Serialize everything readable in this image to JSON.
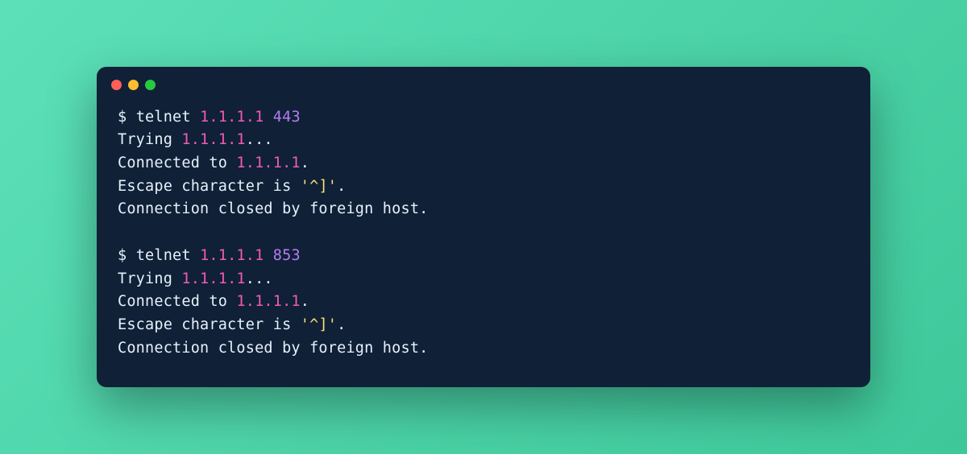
{
  "terminal": {
    "blocks": [
      {
        "prompt": "$ ",
        "command": "telnet",
        "ip": "1.1.1.1",
        "port": "443",
        "output": {
          "trying_prefix": "Trying ",
          "trying_ip": "1.1.1.1",
          "trying_suffix": "...",
          "connected_prefix": "Connected to ",
          "connected_ip": "1.1.1.1",
          "connected_suffix": ".",
          "escape_prefix": "Escape character is ",
          "escape_quote": "'^]'",
          "escape_suffix": ".",
          "closed": "Connection closed by foreign host."
        }
      },
      {
        "prompt": "$ ",
        "command": "telnet",
        "ip": "1.1.1.1",
        "port": "853",
        "output": {
          "trying_prefix": "Trying ",
          "trying_ip": "1.1.1.1",
          "trying_suffix": "...",
          "connected_prefix": "Connected to ",
          "connected_ip": "1.1.1.1",
          "connected_suffix": ".",
          "escape_prefix": "Escape character is ",
          "escape_quote": "'^]'",
          "escape_suffix": ".",
          "closed": "Connection closed by foreign host."
        }
      }
    ]
  }
}
